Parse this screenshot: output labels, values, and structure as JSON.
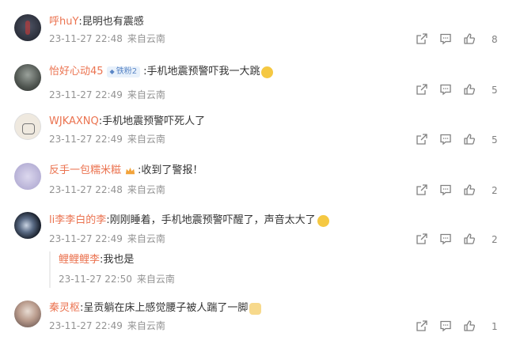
{
  "comments": [
    {
      "user": "呼huY",
      "text": ":昆明也有震感",
      "time": "23-11-27 22:48",
      "location": "来自云南",
      "likes": "8",
      "avatar": "avatar-dark-crescent"
    },
    {
      "user": "怡好心动45",
      "badge": "铁粉2",
      "text": ":手机地震预警吓我一大跳",
      "time": "23-11-27 22:49",
      "location": "来自云南",
      "likes": "5",
      "avatar": "avatar-gray-portrait"
    },
    {
      "user": "WJKAXNQ",
      "text": ":手机地震预警吓死人了",
      "time": "23-11-27 22:49",
      "location": "来自云南",
      "likes": "5",
      "avatar": "avatar-sketch"
    },
    {
      "user": "反手一包糯米糍",
      "text": " :收到了警报！",
      "time": "23-11-27 22:48",
      "location": "来自云南",
      "likes": "2",
      "avatar": "avatar-lilac"
    },
    {
      "user": "li李李白的李",
      "text": ":刚刚睡着，手机地震预警吓醒了，声音太大了",
      "time": "23-11-27 22:49",
      "location": "来自云南",
      "likes": "2",
      "avatar": "avatar-galaxy"
    },
    {
      "user": "秦灵枢",
      "text": ":呈贡躺在床上感觉腰子被人踹了一脚",
      "time": "23-11-27 22:49",
      "location": "来自云南",
      "likes": "1",
      "avatar": "avatar-anime"
    }
  ],
  "reply": {
    "user": "鲤鲤鲤李",
    "text": ":我也是",
    "time": "23-11-27 22:50",
    "location": "来自云南"
  },
  "colors": {
    "username": "#eb7350",
    "meta": "#939393",
    "icon": "#808080"
  },
  "icons": [
    "share-icon",
    "comment-icon",
    "like-icon"
  ]
}
